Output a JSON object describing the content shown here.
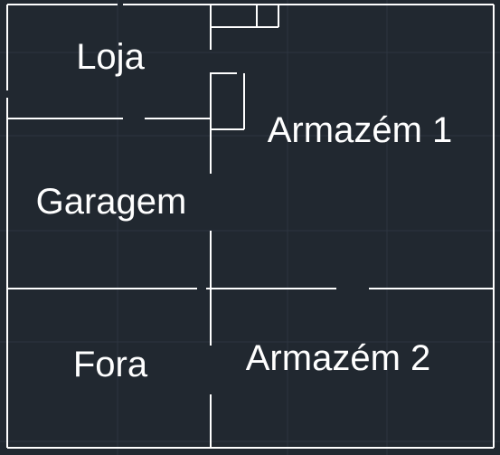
{
  "background_color": "#212830",
  "line_color": "#ffffff",
  "grid_color": "#2d3540",
  "rooms": {
    "loja": "Loja",
    "armazem1": "Armazém 1",
    "garagem": "Garagem",
    "fora": "Fora",
    "armazem2": "Armazém 2"
  }
}
